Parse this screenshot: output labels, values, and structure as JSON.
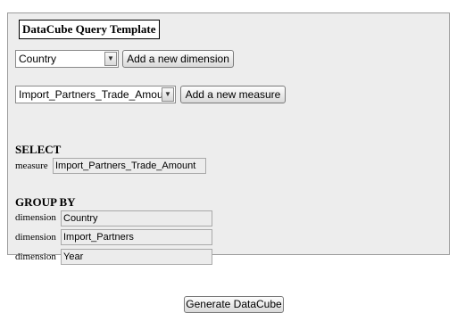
{
  "panel": {
    "title": "DataCube Query Template"
  },
  "dimension_select": {
    "value": "Country"
  },
  "add_dimension_button": {
    "label": "Add a new dimension"
  },
  "measure_select": {
    "value": "Import_Partners_Trade_Amount"
  },
  "add_measure_button": {
    "label": "Add a new measure"
  },
  "select_section": {
    "title": "SELECT",
    "rows": [
      {
        "label": "measure",
        "value": "Import_Partners_Trade_Amount"
      }
    ]
  },
  "group_by_section": {
    "title": "GROUP BY",
    "rows": [
      {
        "label": "dimension",
        "value": "Country"
      },
      {
        "label": "dimension",
        "value": "Import_Partners"
      },
      {
        "label": "dimension",
        "value": "Year"
      }
    ]
  },
  "generate_button": {
    "label": "Generate DataCube"
  }
}
